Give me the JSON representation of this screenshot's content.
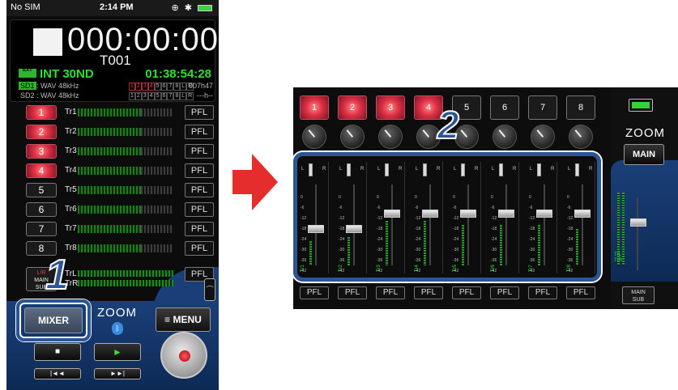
{
  "status_bar": {
    "carrier": "No SIM",
    "time": "2:14 PM",
    "icons": "⊕ ✱"
  },
  "recorder": {
    "counter": "000:00:00",
    "take": "T001",
    "ext_badge": "EXT",
    "input_mode": "INT 30ND",
    "remaining": "01:38:54:28",
    "sd1": {
      "label": "SD1",
      "format": ": WAV 48kHz",
      "tracks": [
        "1",
        "2",
        "3",
        "4",
        "5",
        "6",
        "7",
        "8",
        "L",
        "R"
      ],
      "remain": "007h47"
    },
    "sd2": {
      "label": "SD2",
      "format": ": WAV 48kHz",
      "tracks": [
        "1",
        "2",
        "3",
        "4",
        "5",
        "6",
        "7",
        "8",
        "L",
        "R"
      ],
      "remain": "---h--"
    }
  },
  "channels": [
    {
      "num": "1",
      "track": "Tr1",
      "pfl": "PFL",
      "lit": true
    },
    {
      "num": "2",
      "track": "Tr2",
      "pfl": "PFL",
      "lit": true
    },
    {
      "num": "3",
      "track": "Tr3",
      "pfl": "PFL",
      "lit": true
    },
    {
      "num": "4",
      "track": "Tr4",
      "pfl": "PFL",
      "lit": true
    },
    {
      "num": "5",
      "track": "Tr5",
      "pfl": "PFL",
      "lit": false
    },
    {
      "num": "6",
      "track": "Tr6",
      "pfl": "PFL",
      "lit": false
    },
    {
      "num": "7",
      "track": "Tr7",
      "pfl": "PFL",
      "lit": false
    },
    {
      "num": "8",
      "track": "Tr8",
      "pfl": "PFL",
      "lit": false
    }
  ],
  "lr": {
    "btn_top": "L/R",
    "btn_mid": "MAIN",
    "btn_bot": "SUB",
    "trl": "TrL",
    "trr": "TrR",
    "pfl": "PFL"
  },
  "controls": {
    "mixer": "MIXER",
    "logo": "ZOOM",
    "menu": "≡ MENU",
    "stop": "■",
    "play": "►",
    "rew": "|◄◄",
    "ff": "►►|"
  },
  "callouts": {
    "one": "1",
    "two": "2"
  },
  "mixer_view": {
    "channels": [
      "1",
      "2",
      "3",
      "4",
      "5",
      "6",
      "7",
      "8"
    ],
    "lit_count": 4,
    "scale": [
      "0",
      "-6",
      "-12",
      "-18",
      "-24",
      "-30",
      "-36",
      "-42",
      "-48"
    ],
    "track_labels": [
      "Tr1",
      "Tr2",
      "Tr3",
      "Tr4",
      "Tr5",
      "Tr6",
      "Tr7",
      "Tr8"
    ],
    "fader_positions": [
      0.45,
      0.45,
      0.65,
      0.65,
      0.65,
      0.65,
      0.65,
      0.65
    ],
    "meter_levels": [
      0.3,
      0.35,
      0.55,
      0.55,
      0.5,
      0.5,
      0.5,
      0.45
    ],
    "pfl": "PFL",
    "logo": "ZOOM",
    "main": "MAIN",
    "master_labels": [
      "TrL",
      "TrR"
    ],
    "main_sub": [
      "MAIN",
      "SUB"
    ],
    "pan_l": "L",
    "pan_r": "R"
  },
  "colors": {
    "accent_blue": "#2c5595",
    "arrow_red": "#e52d2d",
    "meter_green": "#2ee02e",
    "lit_red": "#e03045"
  }
}
